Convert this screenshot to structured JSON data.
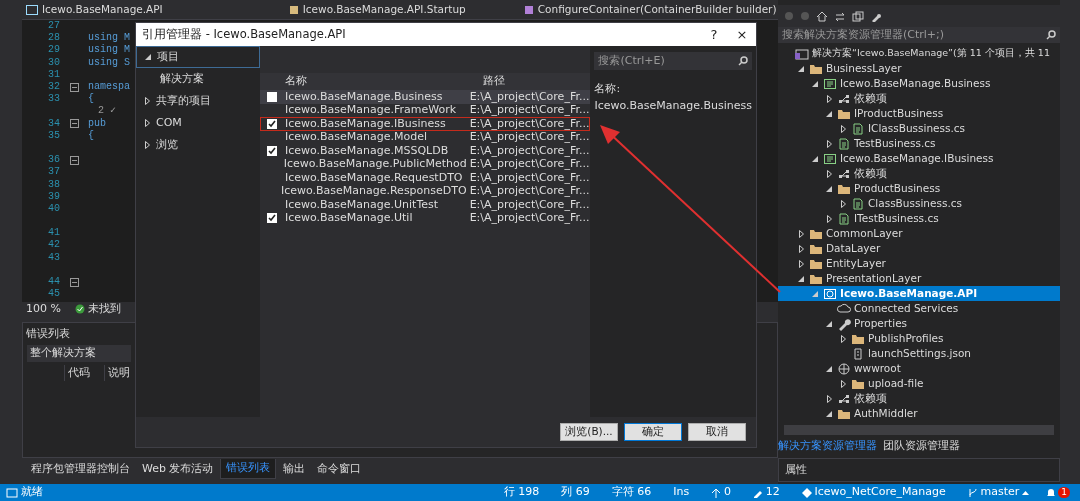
{
  "editor": {
    "tabs": [
      {
        "label": "Icewo.BaseManage.API"
      },
      {
        "label": "Icewo.BaseManage.API.Startup"
      },
      {
        "label": "ConfigureContainer(ContainerBuilder builder)"
      }
    ],
    "lines": [
      {
        "kind": "line",
        "number": "27"
      },
      {
        "kind": "line",
        "number": "28",
        "code": "using M"
      },
      {
        "kind": "line",
        "number": "29",
        "code": "using M"
      },
      {
        "kind": "line",
        "number": "30",
        "code": "using S"
      },
      {
        "kind": "line",
        "number": "31"
      },
      {
        "kind": "line",
        "number": "32",
        "code": "namespa",
        "fold": true
      },
      {
        "kind": "line",
        "number": "33",
        "code": "{"
      },
      {
        "kind": "lens",
        "code": "2 ✓"
      },
      {
        "kind": "line",
        "number": "34",
        "code": "pub",
        "fold": true
      },
      {
        "kind": "line",
        "number": "35",
        "code": "{"
      },
      {
        "kind": "lens"
      },
      {
        "kind": "line",
        "number": "36",
        "fold": true
      },
      {
        "kind": "line",
        "number": "37"
      },
      {
        "kind": "line",
        "number": "38"
      },
      {
        "kind": "line",
        "number": "39"
      },
      {
        "kind": "line",
        "number": "40"
      },
      {
        "kind": "lens"
      },
      {
        "kind": "line",
        "number": "41"
      },
      {
        "kind": "line",
        "number": "42"
      },
      {
        "kind": "line",
        "number": "43"
      },
      {
        "kind": "lens"
      },
      {
        "kind": "line",
        "number": "44",
        "fold": true
      },
      {
        "kind": "line",
        "number": "45"
      }
    ],
    "zoom": "100 %",
    "issues": "未找到"
  },
  "error_list": {
    "title": "错误列表",
    "scope": "整个解决方案",
    "columns": [
      "代码",
      "说明"
    ]
  },
  "bottom_tabs": [
    {
      "label": "程序包管理器控制台",
      "selected": false
    },
    {
      "label": "Web 发布活动",
      "selected": false
    },
    {
      "label": "错误列表",
      "selected": true
    },
    {
      "label": "输出",
      "selected": false
    },
    {
      "label": "命令窗口",
      "selected": false
    }
  ],
  "dialog": {
    "title": "引用管理器 - Icewo.BaseManage.API",
    "help": "?",
    "close": "×",
    "nav": [
      {
        "label": "项目",
        "expanded": true,
        "selected": true,
        "children": [
          {
            "label": "解决方案"
          }
        ]
      },
      {
        "label": "共享的项目",
        "expanded": false,
        "selected": false
      },
      {
        "label": "COM",
        "expanded": false,
        "selected": false
      },
      {
        "label": "浏览",
        "expanded": false,
        "selected": false
      }
    ],
    "search": {
      "placeholder": "搜索(Ctrl+E)"
    },
    "columns": [
      "名称",
      "路径"
    ],
    "rows": [
      {
        "name": "Icewo.BaseManage.Business",
        "path": "E:\\A_project\\Core_Fr...",
        "checked": false,
        "selected": true,
        "highlighted": false
      },
      {
        "name": "Icewo.BaseManage.FrameWork",
        "path": "E:\\A_project\\Core_Fr...",
        "checked": false,
        "selected": false,
        "highlighted": false
      },
      {
        "name": "Icewo.BaseManage.IBusiness",
        "path": "E:\\A_project\\Core_Fr...",
        "checked": true,
        "selected": false,
        "highlighted": true
      },
      {
        "name": "Icewo.BaseManage.Model",
        "path": "E:\\A_project\\Core_Fr...",
        "checked": false,
        "selected": false,
        "highlighted": false
      },
      {
        "name": "Icewo.BaseManage.MSSQLDB",
        "path": "E:\\A_project\\Core_Fr...",
        "checked": true,
        "selected": false,
        "highlighted": false
      },
      {
        "name": "Icewo.BaseManage.PublicMethod",
        "path": "E:\\A_project\\Core_Fr...",
        "checked": false,
        "selected": false,
        "highlighted": false
      },
      {
        "name": "Icewo.BaseManage.RequestDTO",
        "path": "E:\\A_project\\Core_Fr...",
        "checked": false,
        "selected": false,
        "highlighted": false
      },
      {
        "name": "Icewo.BaseManage.ResponseDTO",
        "path": "E:\\A_project\\Core_Fr...",
        "checked": false,
        "selected": false,
        "highlighted": false
      },
      {
        "name": "Icewo.BaseManage.UnitTest",
        "path": "E:\\A_project\\Core_Fr...",
        "checked": false,
        "selected": false,
        "highlighted": false
      },
      {
        "name": "Icewo.BaseManage.Util",
        "path": "E:\\A_project\\Core_Fr...",
        "checked": true,
        "selected": false,
        "highlighted": false
      }
    ],
    "detail_label": "名称:",
    "detail_value": "Icewo.BaseManage.Business",
    "buttons": [
      {
        "label": "浏览(B)...",
        "default": false
      },
      {
        "label": "确定",
        "default": true
      },
      {
        "label": "取消",
        "default": false
      }
    ]
  },
  "explorer": {
    "search": {
      "placeholder": "搜索解决方案资源管理器(Ctrl+;)"
    },
    "tree": [
      {
        "label": "解决方案“Icewo.BaseManage”(第 11 个项目，共 11",
        "kind": "solution",
        "selected": false,
        "children": [
          {
            "label": "BusinessLayer",
            "kind": "folder",
            "expanded": true,
            "selected": false,
            "children": [
              {
                "label": "Icewo.BaseManage.Business",
                "kind": "csproj",
                "expanded": true,
                "selected": false,
                "children": [
                  {
                    "label": "依赖项",
                    "kind": "deps",
                    "expanded": false,
                    "selected": false
                  },
                  {
                    "label": "IProductBusiness",
                    "kind": "folder",
                    "expanded": true,
                    "selected": false,
                    "children": [
                      {
                        "label": "IClassBussiness.cs",
                        "kind": "cs",
                        "expanded": false,
                        "selected": false
                      }
                    ]
                  },
                  {
                    "label": "TestBusiness.cs",
                    "kind": "cs",
                    "expanded": false,
                    "selected": false
                  }
                ]
              },
              {
                "label": "Icewo.BaseManage.IBusiness",
                "kind": "csproj",
                "expanded": true,
                "selected": false,
                "children": [
                  {
                    "label": "依赖项",
                    "kind": "deps",
                    "expanded": false,
                    "selected": false
                  },
                  {
                    "label": "ProductBusiness",
                    "kind": "folder",
                    "expanded": true,
                    "selected": false,
                    "children": [
                      {
                        "label": "ClassBussiness.cs",
                        "kind": "cs",
                        "expanded": false,
                        "selected": false
                      }
                    ]
                  },
                  {
                    "label": "ITestBusiness.cs",
                    "kind": "cs",
                    "expanded": false,
                    "selected": false
                  }
                ]
              }
            ]
          },
          {
            "label": "CommonLayer",
            "kind": "folder",
            "expanded": false,
            "selected": false
          },
          {
            "label": "DataLayer",
            "kind": "folder",
            "expanded": false,
            "selected": false
          },
          {
            "label": "EntityLayer",
            "kind": "folder",
            "expanded": false,
            "selected": false
          },
          {
            "label": "PresentationLayer",
            "kind": "folder",
            "expanded": true,
            "selected": false,
            "children": [
              {
                "label": "Icewo.BaseManage.API",
                "kind": "webproj",
                "expanded": true,
                "selected": true,
                "children": [
                  {
                    "label": "Connected Services",
                    "kind": "cloud",
                    "selected": false
                  },
                  {
                    "label": "Properties",
                    "kind": "wrench",
                    "expanded": true,
                    "selected": false,
                    "children": [
                      {
                        "label": "PublishProfiles",
                        "kind": "folder",
                        "expanded": false,
                        "selected": false
                      },
                      {
                        "label": "launchSettings.json",
                        "kind": "json",
                        "selected": false
                      }
                    ]
                  },
                  {
                    "label": "wwwroot",
                    "kind": "globe",
                    "expanded": true,
                    "selected": false,
                    "children": [
                      {
                        "label": "upload-file",
                        "kind": "folder",
                        "expanded": false,
                        "selected": false
                      }
                    ]
                  },
                  {
                    "label": "依赖项",
                    "kind": "deps",
                    "expanded": false,
                    "selected": false
                  },
                  {
                    "label": "AuthMiddler",
                    "kind": "folder",
                    "expanded": true,
                    "selected": false
                  }
                ]
              }
            ]
          }
        ]
      }
    ],
    "tabs": [
      {
        "label": "解决方案资源管理器",
        "selected": true
      },
      {
        "label": "团队资源管理器",
        "selected": false
      }
    ],
    "properties_title": "属性"
  },
  "status_bar": {
    "state": "就绪",
    "items": [
      {
        "kind": "text",
        "text": "行 198"
      },
      {
        "kind": "text",
        "text": "列 69"
      },
      {
        "kind": "text",
        "text": "字符 66"
      },
      {
        "kind": "text",
        "text": "Ins"
      },
      {
        "kind": "up",
        "text": "0"
      },
      {
        "kind": "pencil",
        "text": "12"
      },
      {
        "kind": "repo",
        "text": "Icewo_NetCore_Manage"
      },
      {
        "kind": "branch",
        "text": "master"
      }
    ],
    "notifications": "1"
  }
}
